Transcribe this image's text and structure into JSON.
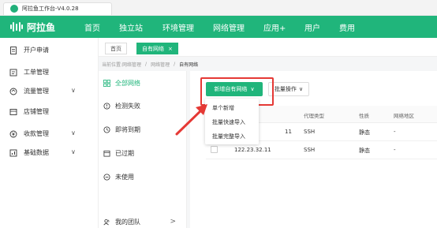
{
  "window": {
    "title": "阿拉鱼工作台-V4.0.28"
  },
  "brand": {
    "name": "阿拉鱼"
  },
  "topnav": {
    "items": [
      "首页",
      "独立站",
      "环境管理",
      "网络管理",
      "应用+",
      "用户",
      "费用"
    ]
  },
  "sidebar": {
    "items": [
      {
        "label": "开户申请",
        "icon": "doc-icon"
      },
      {
        "label": "工单管理",
        "icon": "ticket-icon"
      },
      {
        "label": "流量管理",
        "icon": "traffic-icon",
        "caret": "∨"
      },
      {
        "label": "店铺管理",
        "icon": "store-icon"
      },
      {
        "label": "收款管理",
        "icon": "payment-icon",
        "caret": "∨"
      },
      {
        "label": "基础数据",
        "icon": "data-icon",
        "caret": "∨"
      }
    ]
  },
  "page_tabs": [
    {
      "label": "首页"
    },
    {
      "label": "自有网络",
      "close": "×"
    }
  ],
  "breadcrumb": {
    "prefix": "当前位置:",
    "items": [
      "网络管理",
      "网络管理",
      "自有网络"
    ],
    "separator": "/"
  },
  "filter": {
    "items": [
      {
        "label": "全部网络",
        "active": true
      },
      {
        "label": "检测失败"
      },
      {
        "label": "即将到期"
      },
      {
        "label": "已过期"
      },
      {
        "label": "未使用"
      }
    ],
    "team": {
      "label": "我的团队",
      "caret": ">"
    }
  },
  "toolbar": {
    "add_label": "新增自有网络",
    "add_caret": "∨",
    "batch_label": "批量操作",
    "batch_caret": "∨"
  },
  "add_menu": {
    "items": [
      "单个新增",
      "批量快速导入",
      "批量完整导入"
    ]
  },
  "table": {
    "headers": [
      "代理类型",
      "性质",
      "网络地区"
    ],
    "rows": [
      {
        "ip": "11",
        "type": "SSH",
        "nature": "静态",
        "region": "-"
      },
      {
        "ip": "122.23.32.11",
        "type": "SSH",
        "nature": "静态",
        "region": "-"
      }
    ]
  },
  "colors": {
    "brand": "#20b57b",
    "highlight": "#e53935"
  }
}
